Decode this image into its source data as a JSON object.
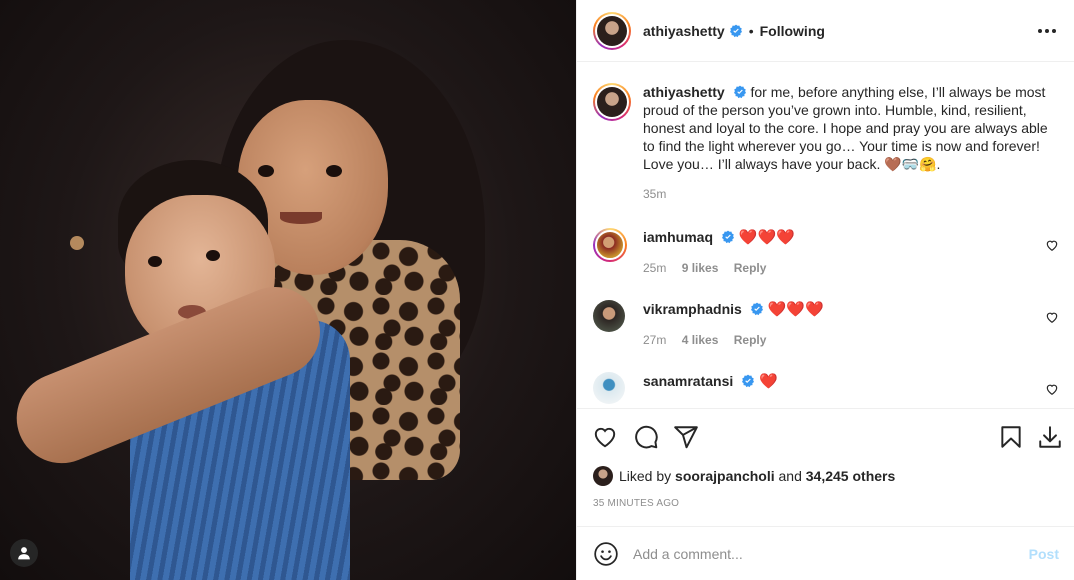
{
  "post": {
    "author": "athiyashetty",
    "follow_status": "Following",
    "separator": "•",
    "caption": "for me, before anything else, I’ll always be most proud of the person you’ve grown into. Humble, kind, resilient, honest and loyal to the core. I hope and pray you are always able to find the light wherever you go… Your time is now and forever! Love you… I’ll always have your back. 🤎🥽🤗.",
    "caption_time": "35m"
  },
  "comments": [
    {
      "username": "iamhumaq",
      "text": "❤️❤️❤️",
      "time": "25m",
      "likes": "9 likes",
      "reply": "Reply"
    },
    {
      "username": "vikramphadnis",
      "text": "❤️❤️❤️",
      "time": "27m",
      "likes": "4 likes",
      "reply": "Reply"
    },
    {
      "username": "sanamratansi",
      "text": "❤️",
      "time": "",
      "likes": "",
      "reply": ""
    }
  ],
  "likes": {
    "prefix": "Liked by",
    "user": "soorajpancholi",
    "conj": "and",
    "others": "34,245 others"
  },
  "timestamp": "35 minutes ago",
  "composer": {
    "placeholder": "Add a comment...",
    "post_label": "Post"
  },
  "icons": {
    "like": "heart-icon",
    "comment": "comment-icon",
    "share": "share-icon",
    "save": "bookmark-icon",
    "download": "download-icon",
    "emoji": "emoji-icon",
    "more": "more-options-icon",
    "verified": "verified-badge-icon",
    "tag": "user-tag-icon"
  },
  "colors": {
    "verified": "#3897f0",
    "heart": "#ed1c24",
    "post_disabled": "#b2dffc",
    "muted": "#8e8e8e"
  }
}
